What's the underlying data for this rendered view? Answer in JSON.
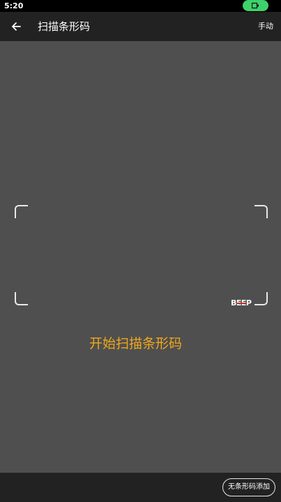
{
  "status_bar": {
    "time": "5:20",
    "battery_icon": "battery-icon",
    "pill_color": "#3dd26b"
  },
  "app_bar": {
    "back_icon": "arrow-left-icon",
    "title": "扫描条形码",
    "manual_label": "手动"
  },
  "scanner": {
    "prompt": "开始扫描条形码",
    "prompt_color": "#f0a81a",
    "watermark": "BEEP"
  },
  "bottom_bar": {
    "no_barcode_label": "无条形码添加"
  }
}
